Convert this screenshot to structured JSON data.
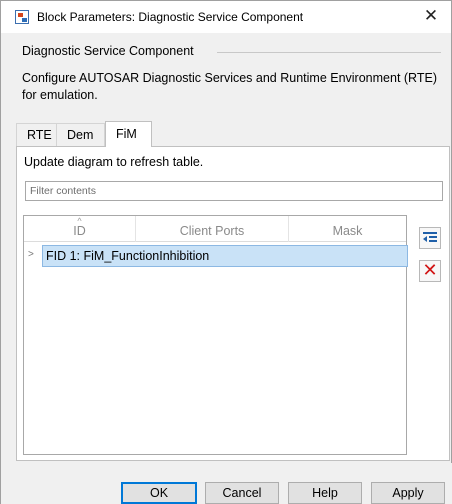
{
  "window": {
    "title": "Block Parameters: Diagnostic Service Component",
    "close_glyph": "✕"
  },
  "group": {
    "label": "Diagnostic Service Component",
    "description": "Configure AUTOSAR Diagnostic Services and Runtime Environment (RTE) for emulation."
  },
  "tabs": [
    {
      "label": "RTE",
      "selected": false
    },
    {
      "label": "Dem",
      "selected": false
    },
    {
      "label": "FiM",
      "selected": true
    }
  ],
  "panel": {
    "update_text": "Update diagram to refresh table.",
    "filter_placeholder": "Filter contents"
  },
  "table": {
    "columns": [
      "ID",
      "Client Ports",
      "Mask"
    ],
    "sort_indicator": "^",
    "rows": [
      {
        "expander": ">",
        "label": "FID 1: FiM_FunctionInhibition",
        "selected": true
      }
    ]
  },
  "side_buttons": {
    "add_icon": "add-row-icon",
    "delete_icon": "delete-icon",
    "delete_glyph": "✕"
  },
  "footer": {
    "ok": "OK",
    "cancel": "Cancel",
    "help": "Help",
    "apply": "Apply"
  },
  "colors": {
    "selection_bg": "#c9e2f7",
    "selection_border": "#8cb8e3",
    "default_button_border": "#0078d7",
    "delete_red": "#d11414"
  }
}
